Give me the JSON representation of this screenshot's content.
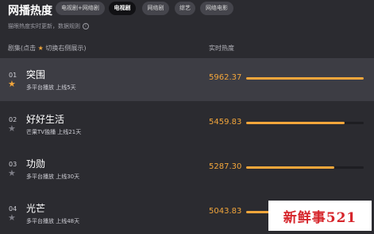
{
  "header": {
    "title": "网播热度",
    "tabs": [
      {
        "label": "电视剧+网络剧",
        "active": false
      },
      {
        "label": "电视剧",
        "active": true
      },
      {
        "label": "网络剧",
        "active": false
      },
      {
        "label": "综艺",
        "active": false
      },
      {
        "label": "网络电影",
        "active": false
      }
    ]
  },
  "notice": "猫眼热度实时更新，数据规则",
  "columns": {
    "name_prefix": "剧集(点击",
    "name_suffix": "切换右侧展示)",
    "heat": "实时热度"
  },
  "rows": [
    {
      "rank": "01",
      "title": "突围",
      "meta": "多平台播放  上线5天",
      "heat": "5962.37",
      "fill": 1.0
    },
    {
      "rank": "02",
      "title": "好好生活",
      "meta": "芒果TV独播  上线21天",
      "heat": "5459.83",
      "fill": 0.84
    },
    {
      "rank": "03",
      "title": "功勋",
      "meta": "多平台播放  上线30天",
      "heat": "5287.30",
      "fill": 0.75
    },
    {
      "rank": "04",
      "title": "光芒",
      "meta": "多平台播放  上线48天",
      "heat": "5043.83",
      "fill": 0.3
    }
  ],
  "watermark": "新鲜事521",
  "colors": {
    "accent": "#f3a63b",
    "background": "#2b2b30",
    "highlight_row": "#3d3d44"
  }
}
